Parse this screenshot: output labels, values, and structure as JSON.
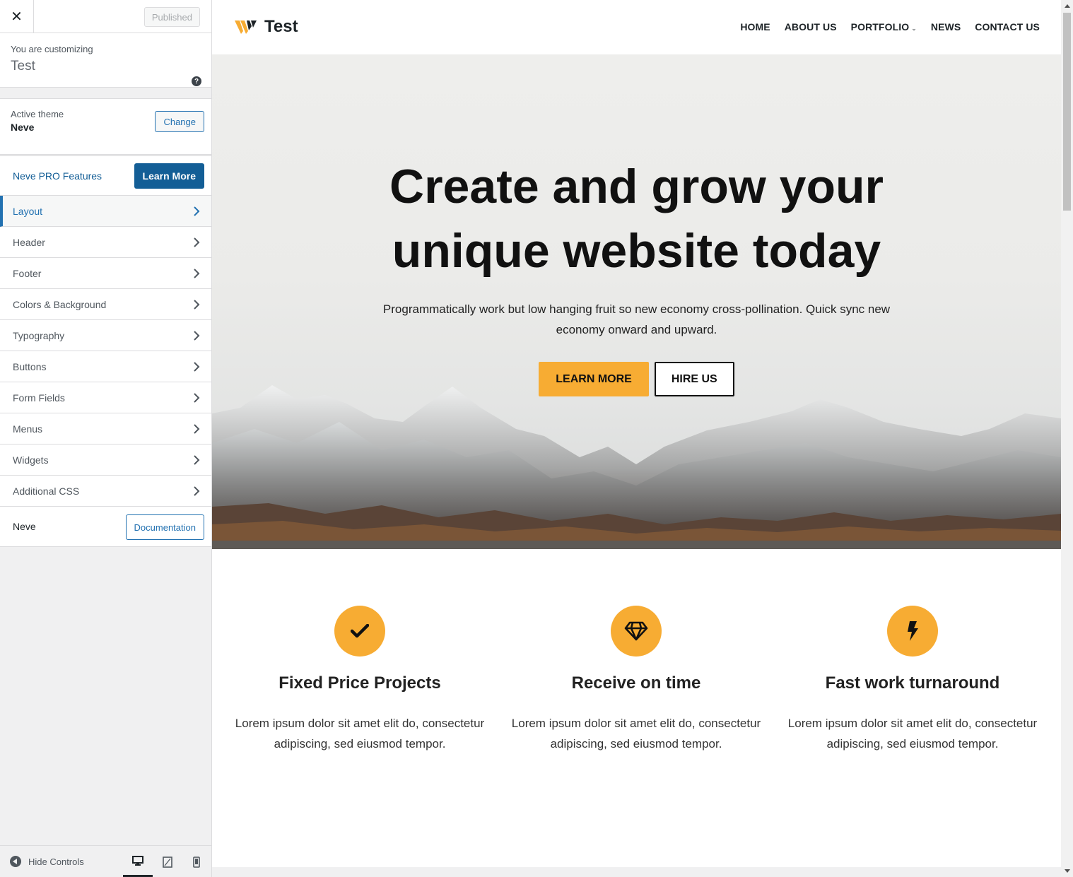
{
  "sidebar": {
    "close_icon": "close-icon",
    "status_label": "Published",
    "customizing_label": "You are customizing",
    "customizing_title": "Test",
    "help_label": "?",
    "active_theme_label": "Active theme",
    "active_theme_name": "Neve",
    "change_label": "Change",
    "pro_label": "Neve PRO Features",
    "learn_more_label": "Learn More",
    "items": [
      {
        "label": "Layout"
      },
      {
        "label": "Header"
      },
      {
        "label": "Footer"
      },
      {
        "label": "Colors & Background"
      },
      {
        "label": "Typography"
      },
      {
        "label": "Buttons"
      },
      {
        "label": "Form Fields"
      },
      {
        "label": "Menus"
      },
      {
        "label": "Widgets"
      },
      {
        "label": "Additional CSS"
      }
    ],
    "neve_label": "Neve",
    "documentation_label": "Documentation",
    "hide_controls_label": "Hide Controls",
    "devices": [
      "desktop",
      "tablet",
      "mobile"
    ],
    "active_device": "desktop"
  },
  "site": {
    "title": "Test",
    "nav": [
      {
        "label": "HOME"
      },
      {
        "label": "ABOUT US"
      },
      {
        "label": "PORTFOLIO",
        "caret": "⌄"
      },
      {
        "label": "NEWS"
      },
      {
        "label": "CONTACT US"
      }
    ],
    "hero": {
      "heading_line1": "Create and grow your",
      "heading_line2": "unique website today",
      "text": "Programmatically work but low hanging fruit so new economy cross-pollination. Quick sync new economy onward and upward.",
      "primary_button": "LEARN MORE",
      "secondary_button": "HIRE US"
    },
    "features": [
      {
        "icon": "checkmark-icon",
        "title": "Fixed Price Projects",
        "text": "Lorem ipsum dolor sit amet elit do, consectetur adipiscing, sed eiusmod tempor."
      },
      {
        "icon": "diamond-icon",
        "title": "Receive on time",
        "text": "Lorem ipsum dolor sit amet elit do, consectetur adipiscing, sed eiusmod tempor."
      },
      {
        "icon": "lightning-icon",
        "title": "Fast work turnaround",
        "text": "Lorem ipsum dolor sit amet elit do, consectetur adipiscing, sed eiusmod tempor."
      }
    ]
  },
  "colors": {
    "accent": "#f7ac33",
    "wp_blue": "#2271b1",
    "wp_dark_blue": "#135e96",
    "text_dark": "#111111"
  }
}
